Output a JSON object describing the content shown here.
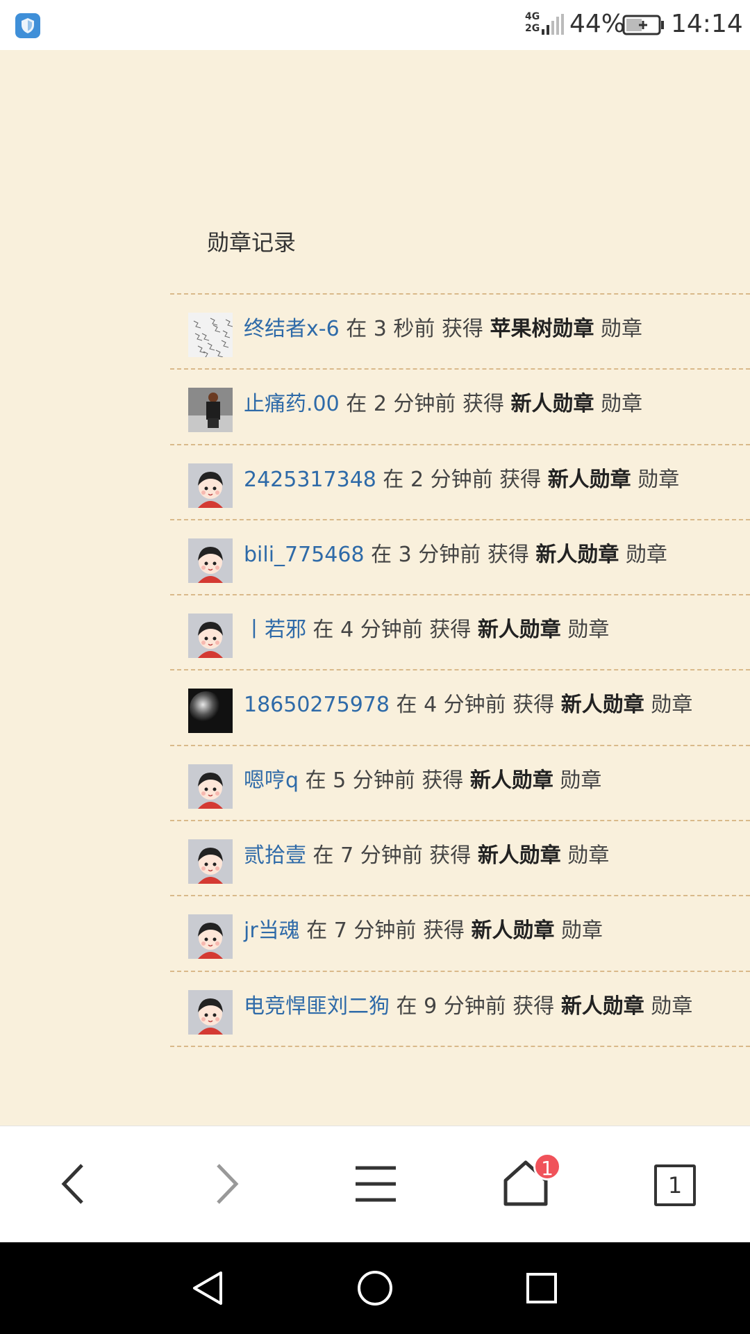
{
  "status_bar": {
    "network": "4G",
    "network2": "2G",
    "battery_percent": "44%",
    "time": "14:14"
  },
  "section_title": "勋章记录",
  "records": [
    {
      "user": "终结者x-6",
      "at": "在",
      "time": "3 秒前",
      "obtain": "获得",
      "badge": "苹果树勋章",
      "suffix": "勋章",
      "avatar": "sketch"
    },
    {
      "user": "止痛药.00",
      "at": "在",
      "time": "2 分钟前",
      "obtain": "获得",
      "badge": "新人勋章",
      "suffix": "勋章",
      "avatar": "photo-person"
    },
    {
      "user": "2425317348",
      "at": "在",
      "time": "2 分钟前",
      "obtain": "获得",
      "badge": "新人勋章",
      "suffix": "勋章",
      "avatar": "default"
    },
    {
      "user": "bili_775468",
      "at": "在",
      "time": "3 分钟前",
      "obtain": "获得",
      "badge": "新人勋章",
      "suffix": "勋章",
      "avatar": "default"
    },
    {
      "user": "丨若邪",
      "at": "在",
      "time": "4 分钟前",
      "obtain": "获得",
      "badge": "新人勋章",
      "suffix": "勋章",
      "avatar": "default"
    },
    {
      "user": "18650275978",
      "at": "在",
      "time": "4 分钟前",
      "obtain": "获得",
      "badge": "新人勋章",
      "suffix": "勋章",
      "avatar": "dark-photo"
    },
    {
      "user": "嗯哼q",
      "at": "在",
      "time": "5 分钟前",
      "obtain": "获得",
      "badge": "新人勋章",
      "suffix": "勋章",
      "avatar": "default"
    },
    {
      "user": "贰拾壹",
      "at": "在",
      "time": "7 分钟前",
      "obtain": "获得",
      "badge": "新人勋章",
      "suffix": "勋章",
      "avatar": "default"
    },
    {
      "user": "jr当魂",
      "at": "在",
      "time": "7 分钟前",
      "obtain": "获得",
      "badge": "新人勋章",
      "suffix": "勋章",
      "avatar": "default"
    },
    {
      "user": "电竞悍匪刘二狗",
      "at": "在",
      "time": "9 分钟前",
      "obtain": "获得",
      "badge": "新人勋章",
      "suffix": "勋章",
      "avatar": "default"
    }
  ],
  "toolbar": {
    "home_badge_count": "1",
    "tabs_count": "1",
    "icons": [
      "back-icon",
      "forward-icon",
      "menu-icon",
      "home-icon",
      "tabs-icon"
    ]
  },
  "system_nav": {
    "icons": [
      "triangle-back-icon",
      "circle-home-icon",
      "square-recent-icon"
    ]
  },
  "colors": {
    "page_bg": "#f9f0dc",
    "username": "#2e6aa8",
    "divider": "#d9b98a",
    "badge_notification": "#f0525a"
  }
}
